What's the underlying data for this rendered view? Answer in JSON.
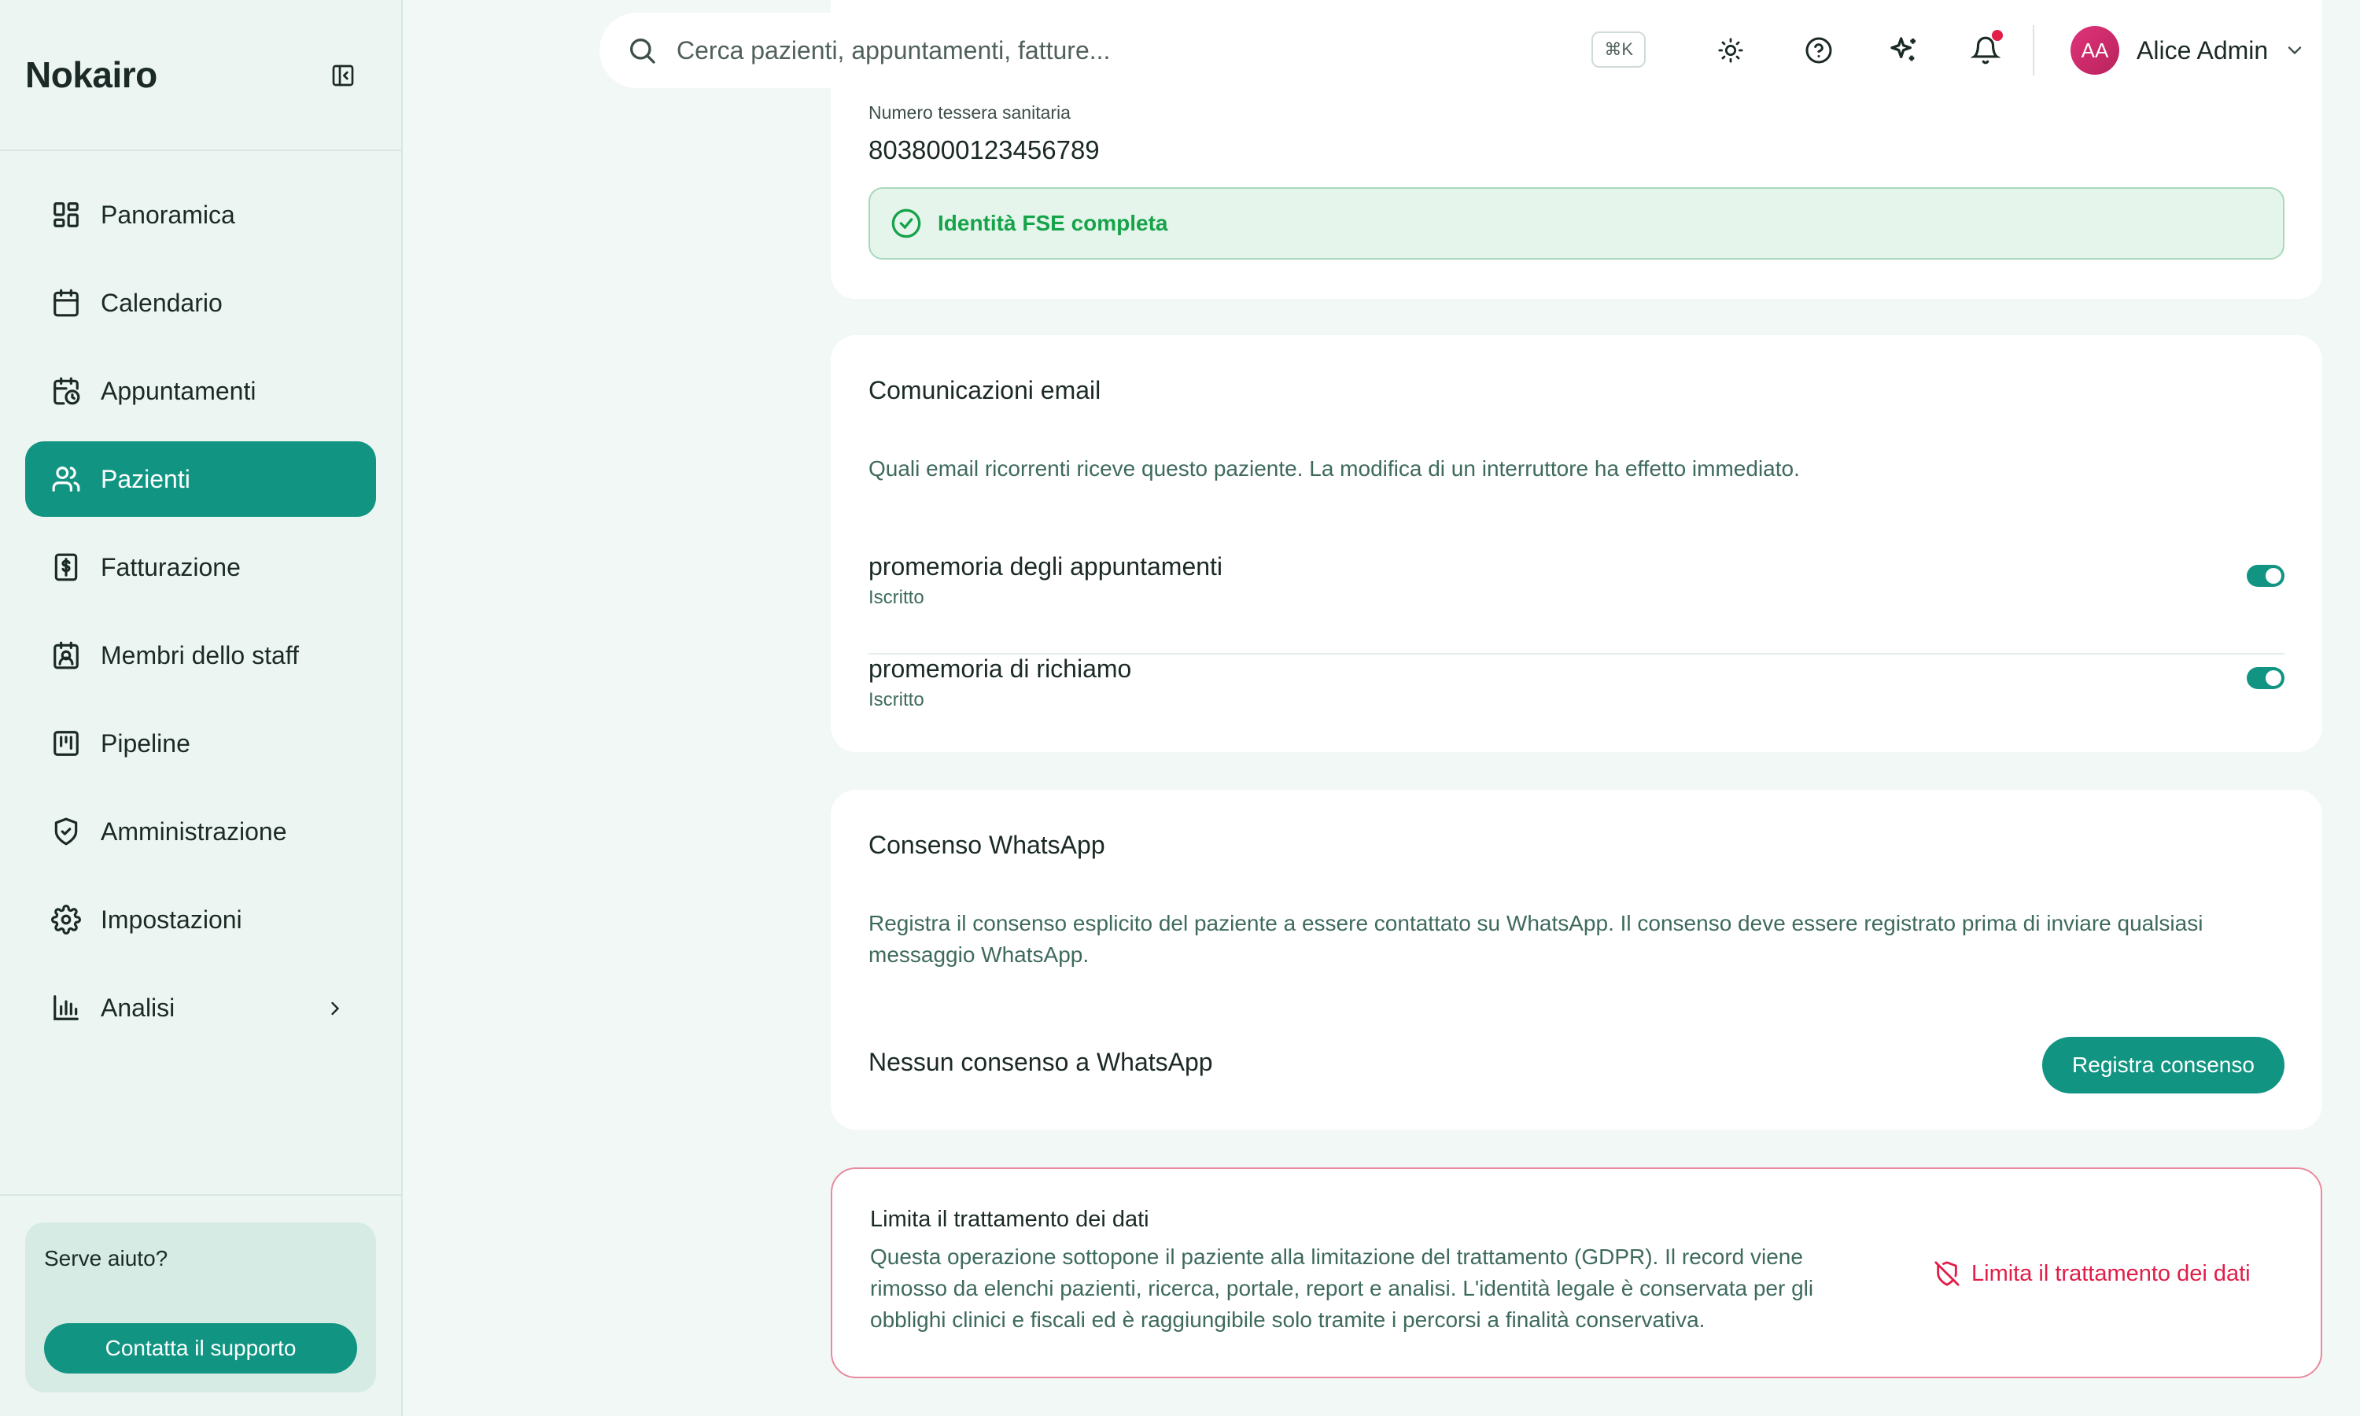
{
  "app": {
    "brand": "Nokairo"
  },
  "sidebar": {
    "items": [
      {
        "label": "Panoramica",
        "icon": "dashboard-icon",
        "active": false
      },
      {
        "label": "Calendario",
        "icon": "calendar-icon",
        "active": false
      },
      {
        "label": "Appuntamenti",
        "icon": "calendar-clock-icon",
        "active": false
      },
      {
        "label": "Pazienti",
        "icon": "users-icon",
        "active": true
      },
      {
        "label": "Fatturazione",
        "icon": "invoice-icon",
        "active": false
      },
      {
        "label": "Membri dello staff",
        "icon": "staff-badge-icon",
        "active": false
      },
      {
        "label": "Pipeline",
        "icon": "kanban-icon",
        "active": false
      },
      {
        "label": "Amministrazione",
        "icon": "shield-check-icon",
        "active": false
      },
      {
        "label": "Impostazioni",
        "icon": "gear-icon",
        "active": false
      },
      {
        "label": "Analisi",
        "icon": "bar-chart-icon",
        "active": false
      }
    ],
    "help": {
      "title": "Serve aiuto?",
      "button": "Contatta il supporto"
    }
  },
  "topbar": {
    "search_placeholder": "Cerca pazienti, appuntamenti, fatture...",
    "shortcut": "⌘K",
    "user": {
      "initials": "AA",
      "name": "Alice Admin"
    },
    "has_notification": true
  },
  "identity": {
    "field_label": "Numero tessera sanitaria",
    "field_value": "8038000123456789",
    "banner": "Identità FSE completa"
  },
  "email_prefs": {
    "title": "Comunicazioni email",
    "description": "Quali email ricorrenti riceve questo paziente. La modifica di un interruttore ha effetto immediato.",
    "items": [
      {
        "name": "promemoria degli appuntamenti",
        "status": "Iscritto",
        "enabled": true
      },
      {
        "name": "promemoria di richiamo",
        "status": "Iscritto",
        "enabled": true
      }
    ]
  },
  "whatsapp": {
    "title": "Consenso WhatsApp",
    "description": "Registra il consenso esplicito del paziente a essere contattato su WhatsApp. Il consenso deve essere registrato prima di inviare qualsiasi messaggio WhatsApp.",
    "status": "Nessun consenso a WhatsApp",
    "button": "Registra consenso"
  },
  "gdpr": {
    "title": "Limita il trattamento dei dati",
    "description": "Questa operazione sottopone il paziente alla limitazione del trattamento (GDPR). Il record viene rimosso da elenchi pazienti, ricerca, portale, report e analisi. L'identità legale è conservata per gli obblighi clinici e fiscali ed è raggiungibile solo tramite i percorsi a finalità conservativa.",
    "button": "Limita il trattamento dei dati"
  },
  "colors": {
    "accent": "#119582",
    "success": "#16a34a",
    "danger": "#e11d48",
    "background": "#f1f8f5"
  }
}
